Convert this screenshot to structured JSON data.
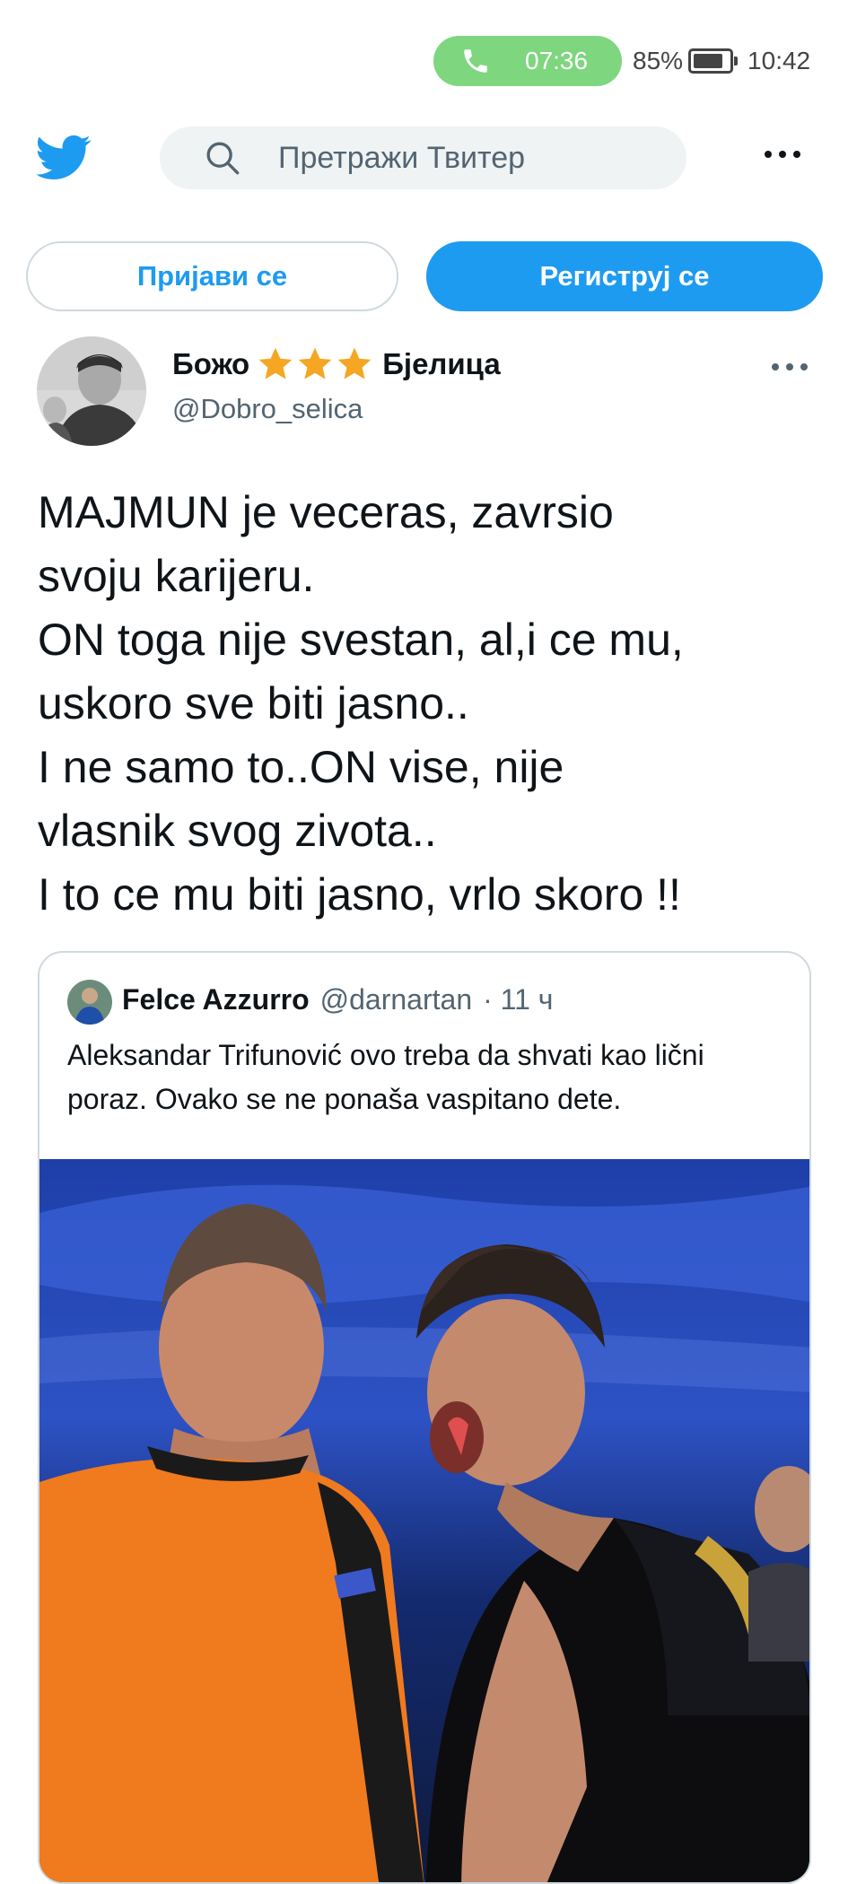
{
  "status_bar": {
    "call_time": "07:36",
    "battery": "85%",
    "clock": "10:42"
  },
  "header": {
    "search_placeholder": "Претражи Твитер"
  },
  "auth": {
    "login_label": "Пријави се",
    "signup_label": "Региструј се"
  },
  "tweet": {
    "author_first": "Божо",
    "author_last": "Бјелица",
    "star_count": 3,
    "handle": "@Dobro_selica",
    "text": "MAJMUN je veceras, zavrsio\nsvoju karijeru.\nON toga nije svestan, al,i ce mu,\nuskoro sve biti jasno..\nI ne samo to..ON vise, nije\nvlasnik svog zivota..\nI to ce mu biti jasno, vrlo skoro !!"
  },
  "quoted": {
    "author": "Felce Azzurro",
    "handle": "@darnartan",
    "time": "· 11 ч",
    "text": "Aleksandar Trifunović ovo treba da shvati kao lični poraz. Ovako se ne ponaša vaspitano dete."
  },
  "colors": {
    "brand": "#1d9bf0",
    "call_pill": "#7ed67f",
    "star": "#f5a623"
  },
  "icons": [
    "phone-icon",
    "battery-icon",
    "twitter-bird-icon",
    "search-icon",
    "more-icon",
    "star-icon"
  ]
}
